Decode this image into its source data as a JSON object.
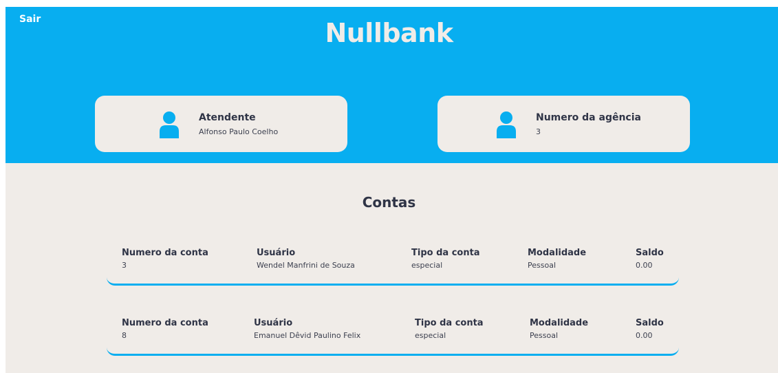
{
  "header": {
    "logout_label": "Sair",
    "brand": "Nullbank",
    "background_color": "#08aef0"
  },
  "cards": [
    {
      "title": "Atendente",
      "value": "Alfonso Paulo Coelho",
      "icon": "user-icon"
    },
    {
      "title": "Numero da agência",
      "value": "3",
      "icon": "user-icon"
    }
  ],
  "accounts_section": {
    "title": "Contas",
    "columns": [
      "Numero da conta",
      "Usuário",
      "Tipo da conta",
      "Modalidade",
      "Saldo"
    ],
    "rows": [
      {
        "numero": "3",
        "usuario": "Wendel Manfrini de Souza",
        "tipo": "especial",
        "modalidade": "Pessoal",
        "saldo": "0.00"
      },
      {
        "numero": "8",
        "usuario": "Emanuel Dêvid Paulino Felix",
        "tipo": "especial",
        "modalidade": "Pessoal",
        "saldo": "0.00"
      }
    ]
  }
}
